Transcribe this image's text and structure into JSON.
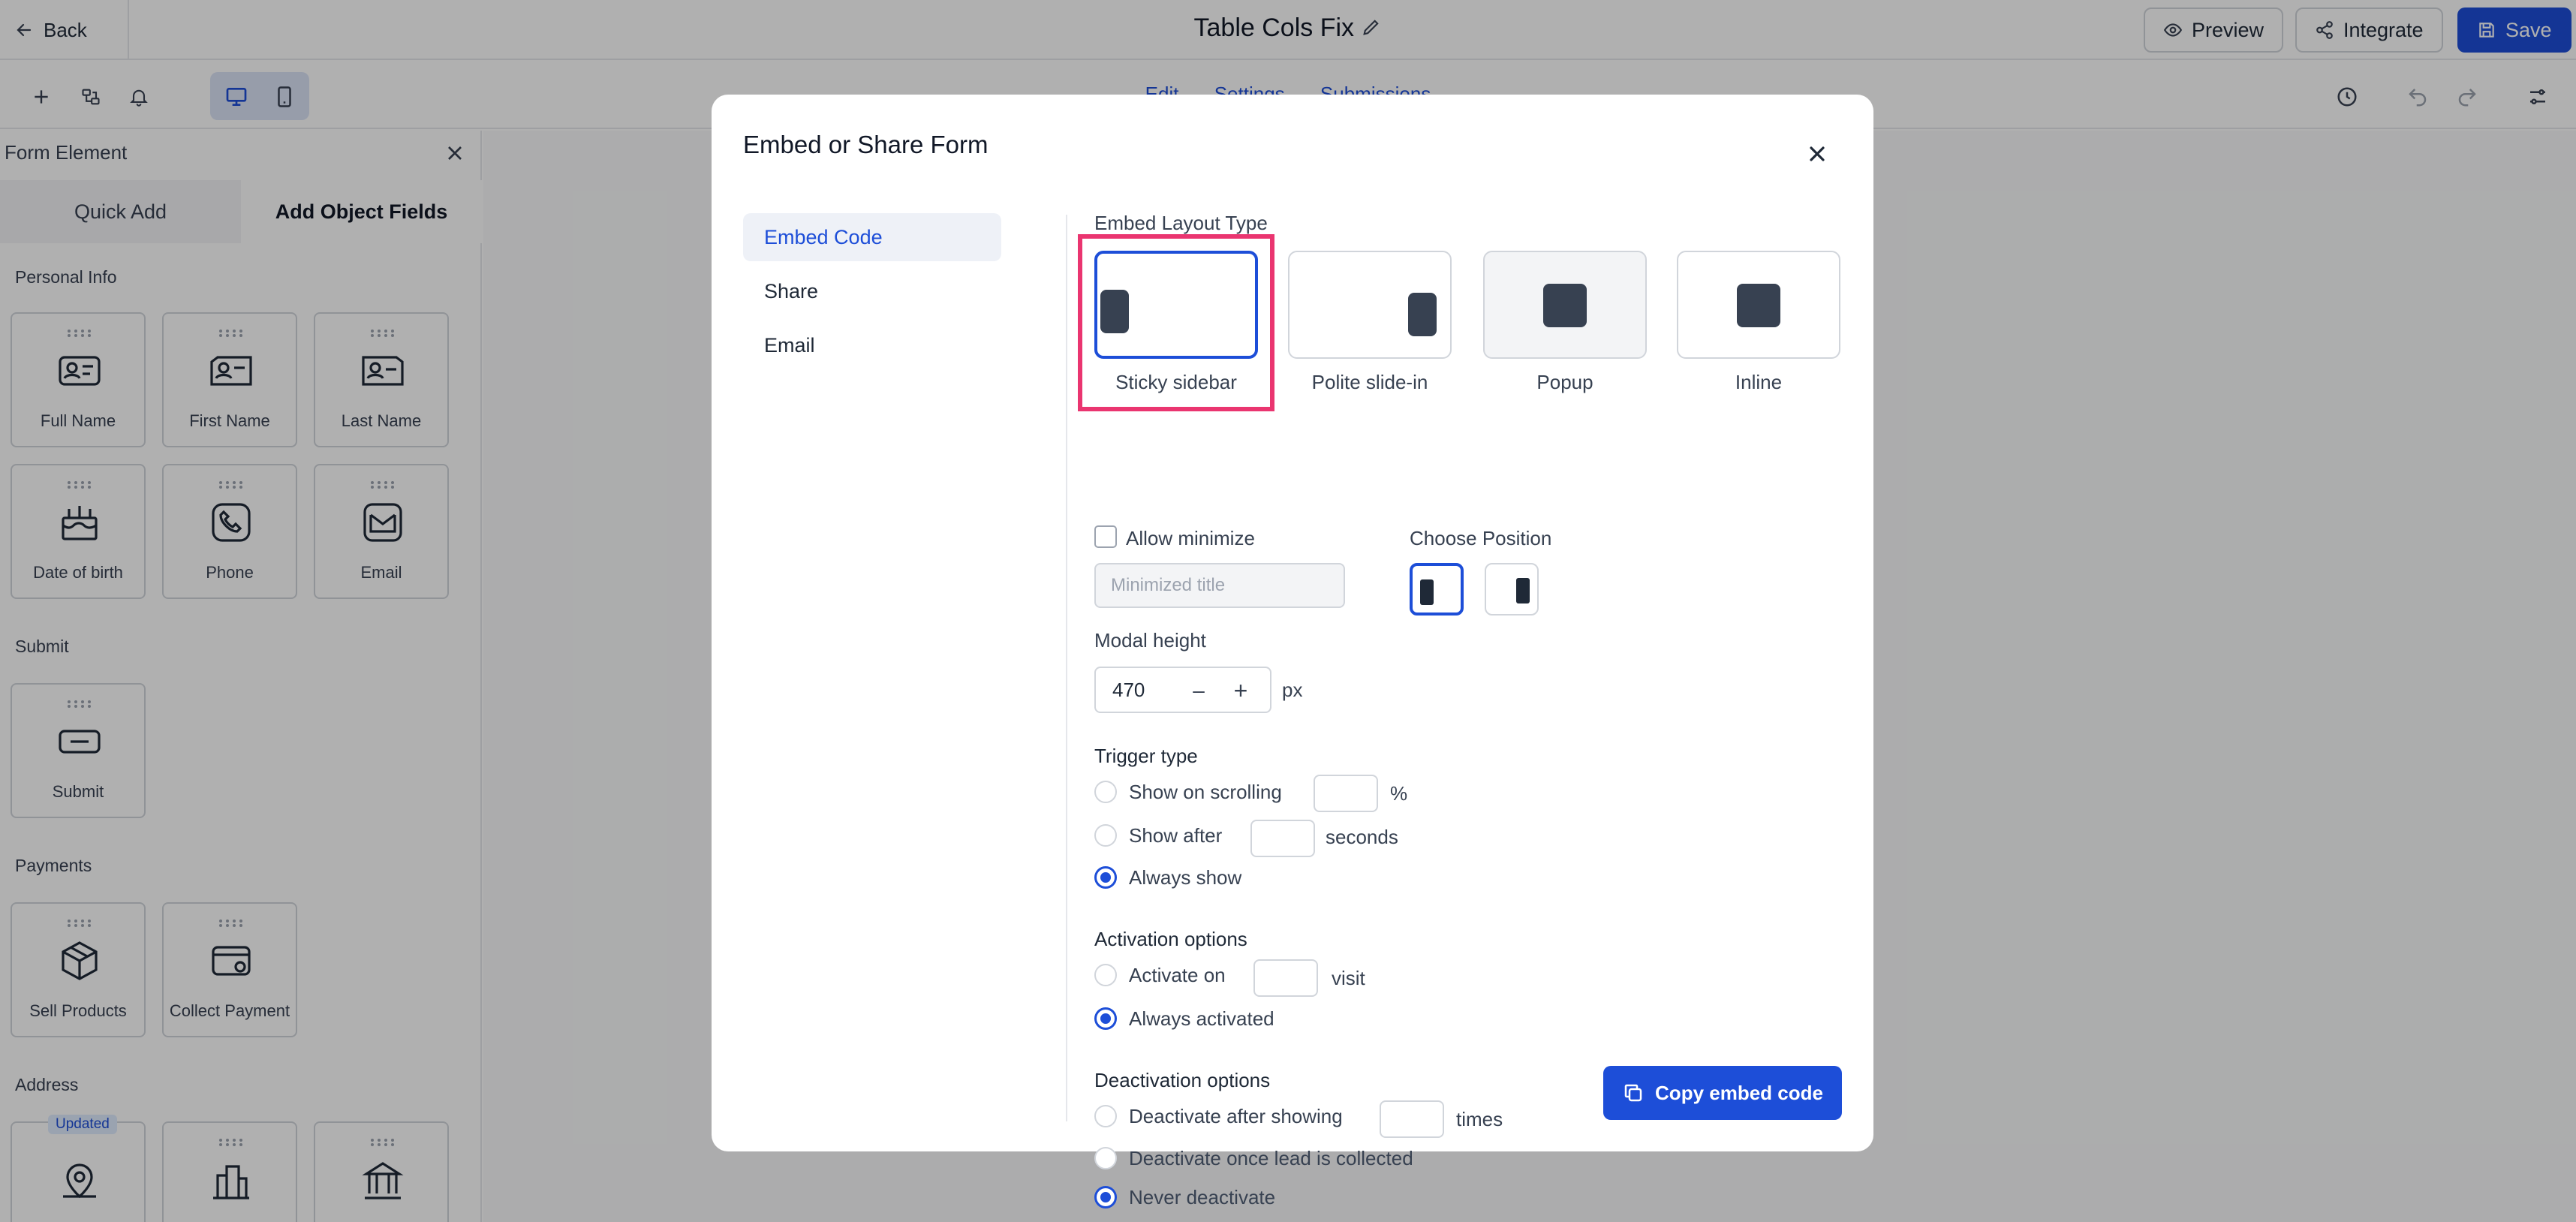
{
  "topbar": {
    "back_label": "Back",
    "title": "Table Cols Fix",
    "preview_label": "Preview",
    "integrate_label": "Integrate",
    "save_label": "Save"
  },
  "editor_tabs": [
    "Edit",
    "Settings",
    "Submissions"
  ],
  "sidebar": {
    "title": "Form Element",
    "tabs": {
      "quick_add": "Quick Add",
      "add_object_fields": "Add Object Fields"
    },
    "sections": {
      "personal_info": "Personal Info",
      "submit": "Submit",
      "payments": "Payments",
      "address": "Address"
    },
    "personal_fields": [
      {
        "label": "Full Name",
        "icon": "id-card-icon"
      },
      {
        "label": "First Name",
        "icon": "id-card-icon"
      },
      {
        "label": "Last Name",
        "icon": "id-card-icon"
      },
      {
        "label": "Date of birth",
        "icon": "cake-icon"
      },
      {
        "label": "Phone",
        "icon": "phone-icon"
      },
      {
        "label": "Email",
        "icon": "mail-icon"
      }
    ],
    "submit_fields": [
      {
        "label": "Submit",
        "icon": "submit-icon"
      }
    ],
    "payment_fields": [
      {
        "label": "Sell Products",
        "icon": "box-icon"
      },
      {
        "label": "Collect Payment",
        "icon": "card-icon"
      }
    ],
    "address_badge": "Updated"
  },
  "modal": {
    "title": "Embed or Share Form",
    "nav": [
      {
        "label": "Embed Code",
        "active": true
      },
      {
        "label": "Share",
        "active": false
      },
      {
        "label": "Email",
        "active": false
      }
    ],
    "layout_type_label": "Embed Layout Type",
    "layouts": [
      {
        "label": "Sticky sidebar",
        "selected": true
      },
      {
        "label": "Polite slide-in",
        "selected": false
      },
      {
        "label": "Popup",
        "selected": false
      },
      {
        "label": "Inline",
        "selected": false
      }
    ],
    "allow_minimize_label": "Allow minimize",
    "allow_minimize_checked": false,
    "minimized_title_placeholder": "Minimized title",
    "choose_position_label": "Choose Position",
    "position_selected": "left",
    "modal_height_label": "Modal height",
    "modal_height_value": "470",
    "modal_height_unit": "px",
    "trigger_type_label": "Trigger type",
    "trigger_options": {
      "scrolling": "Show on scrolling",
      "scrolling_unit": "%",
      "after": "Show after",
      "after_unit": "seconds",
      "always": "Always show"
    },
    "trigger_selected": "always",
    "activation_label": "Activation options",
    "activation_options": {
      "activate_on": "Activate on",
      "activate_on_unit": "visit",
      "always": "Always activated"
    },
    "activation_selected": "always",
    "deactivation_label": "Deactivation options",
    "deactivation_options": {
      "after_showing": "Deactivate after showing",
      "after_showing_unit": "times",
      "once_lead": "Deactivate once lead is collected",
      "never": "Never deactivate"
    },
    "deactivation_selected": "never",
    "copy_button_label": "Copy embed code"
  },
  "colors": {
    "primary": "#1d4ed8",
    "highlight": "#ea3570",
    "overlay": "rgba(0,0,0,0.31)"
  }
}
